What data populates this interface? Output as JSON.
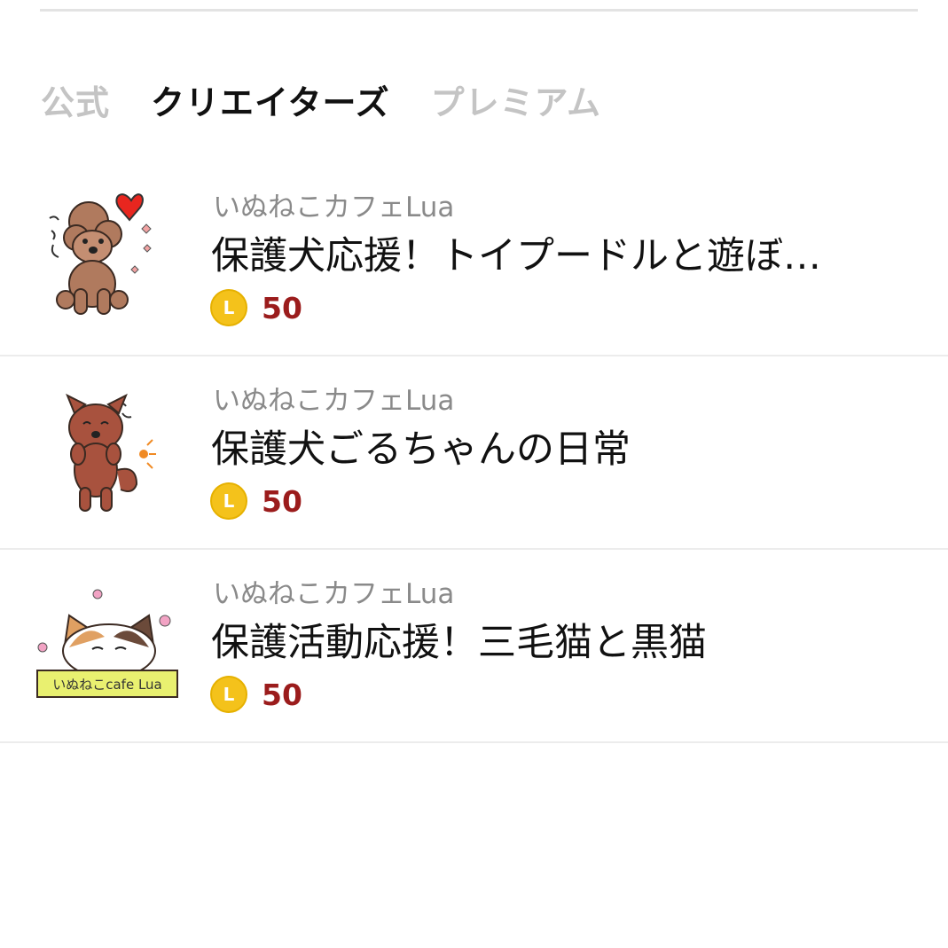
{
  "tabs": [
    {
      "label": "公式",
      "active": false
    },
    {
      "label": "クリエイターズ",
      "active": true
    },
    {
      "label": "プレミアム",
      "active": false
    }
  ],
  "items": [
    {
      "creator": "いぬねこカフェLua",
      "title": "保護犬応援！トイプードルと遊ぼ…",
      "coin_icon": "coin-icon",
      "coin_letter": "L",
      "price": "50"
    },
    {
      "creator": "いぬねこカフェLua",
      "title": "保護犬ごるちゃんの日常",
      "coin_icon": "coin-icon",
      "coin_letter": "L",
      "price": "50"
    },
    {
      "creator": "いぬねこカフェLua",
      "title": "保護活動応援！三毛猫と黒猫",
      "coin_icon": "coin-icon",
      "coin_letter": "L",
      "price": "50"
    }
  ],
  "thumb3_logo_text": "いぬねこcafe Lua",
  "colors": {
    "price": "#9b1c1c",
    "coin": "#f4c21b",
    "tab_active": "#111111",
    "tab_inactive": "#c4c4c4"
  }
}
